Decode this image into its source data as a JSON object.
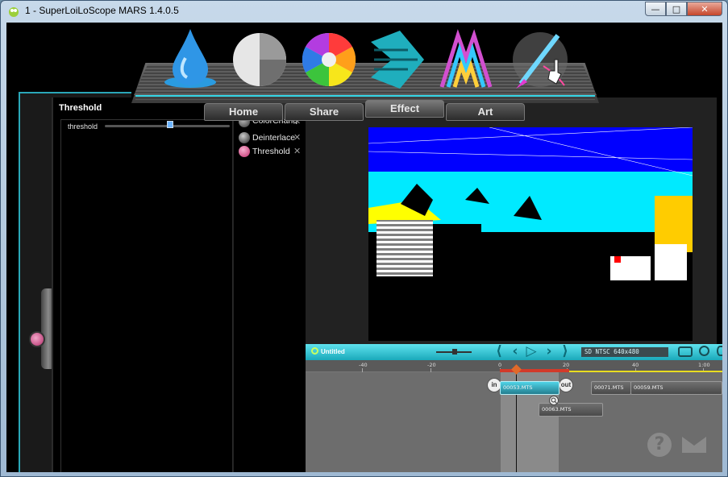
{
  "window": {
    "title": "1 - SuperLoiLoScope MARS 1.4.0.5",
    "minimize": "—",
    "maximize": "□",
    "close": "✕"
  },
  "tabs": [
    {
      "label": "Home"
    },
    {
      "label": "Share"
    },
    {
      "label": "Effect"
    },
    {
      "label": "Art"
    }
  ],
  "nav_icons": [
    "water-drop-icon",
    "pie-shape-icon",
    "color-wheel-icon",
    "arrow-shape-icon",
    "art-logo-icon",
    "paintbrush-icon"
  ],
  "panel": {
    "title": "Threshold",
    "param_label": "threshold",
    "threshold_value": 0.52
  },
  "effects": [
    {
      "label": "ColorChang",
      "remove": "✕"
    },
    {
      "label": "Deinterlace",
      "remove": "✕"
    },
    {
      "label": "Threshold",
      "remove": "✕"
    }
  ],
  "timeline": {
    "title": "Untitled",
    "format": "SD NTSC   640x480",
    "ticks": [
      "-40",
      "-20",
      "0",
      "20",
      "40",
      "1:00"
    ],
    "in_label": "in",
    "out_label": "out",
    "clips": [
      "00053.MTS",
      "00071.MTS",
      "00059.MTS",
      "00063.MTS"
    ],
    "controls": {
      "prev_start": "⟨",
      "prev": "‹",
      "play": "▷",
      "next": "›",
      "next_end": "⟩"
    }
  },
  "footer": {
    "help": "?"
  },
  "colors": {
    "accent": "#2fc9dc",
    "selected_clip": "#3ec1d4",
    "playhead": "#e06a2a"
  }
}
